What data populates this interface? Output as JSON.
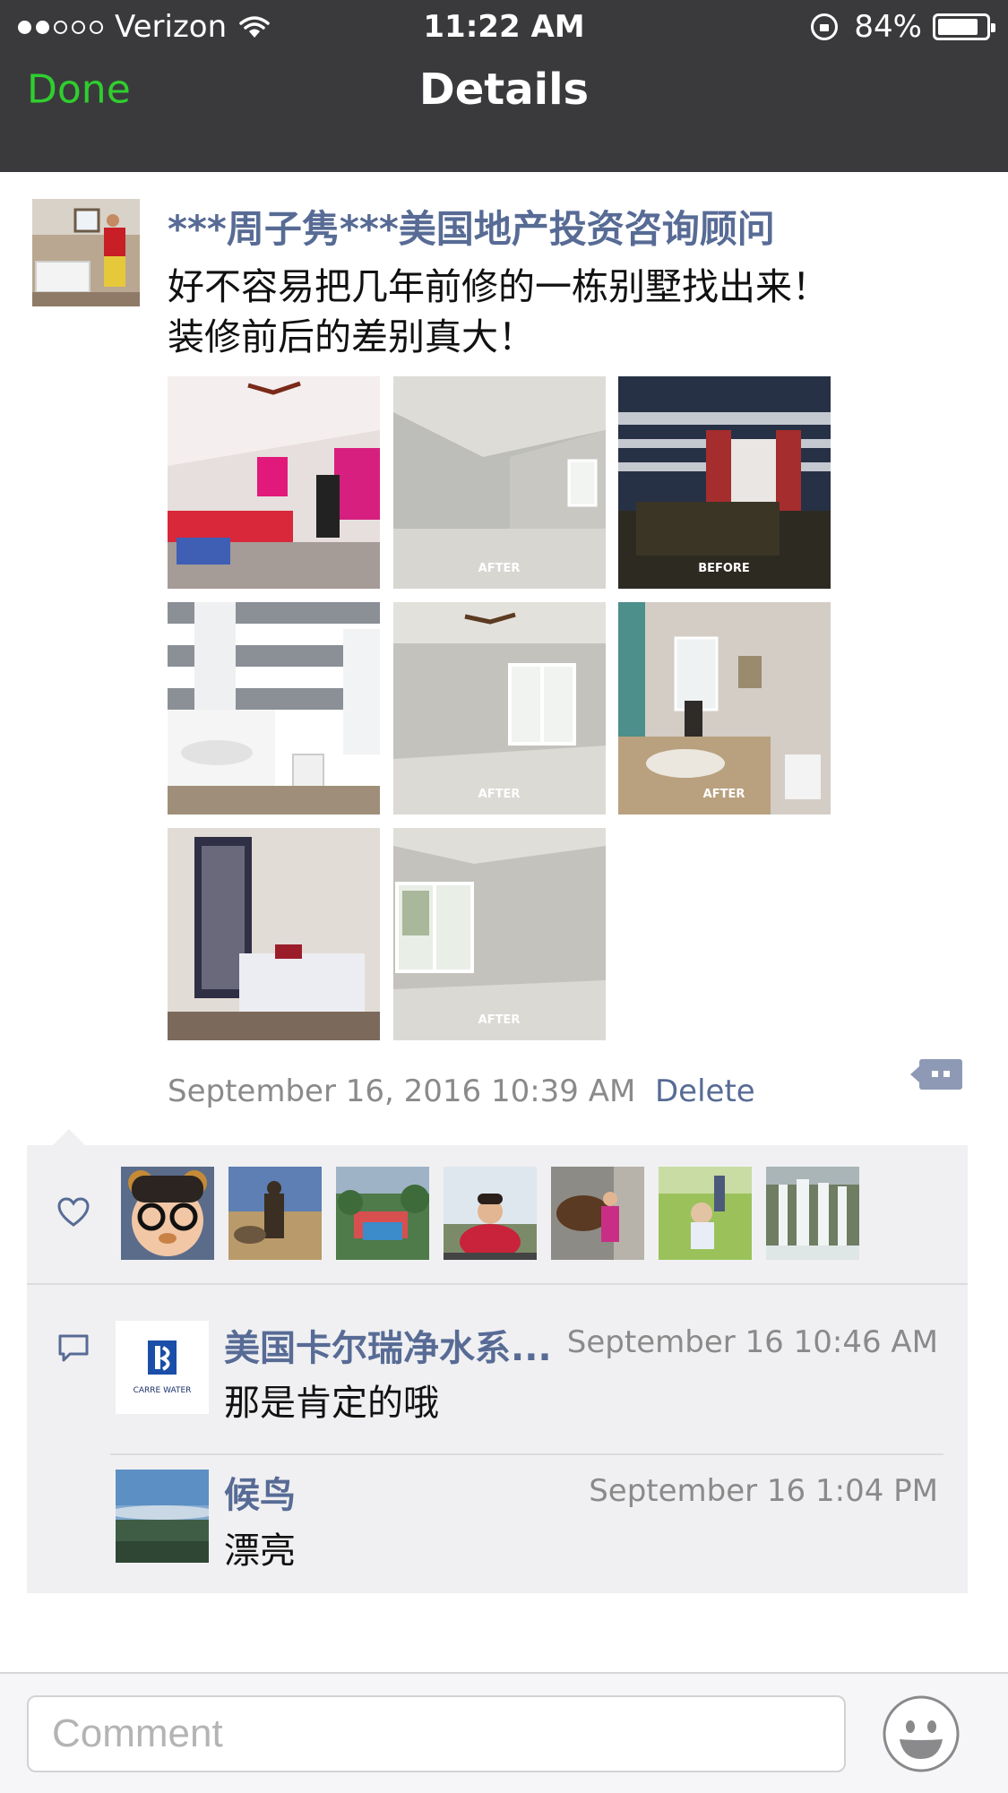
{
  "status_bar": {
    "signal_bars_filled": 2,
    "signal_bars_total": 5,
    "carrier": "Verizon",
    "time": "11:22 AM",
    "battery": "84%",
    "battery_level": 0.84
  },
  "nav": {
    "done_label": "Done",
    "title": "Details"
  },
  "post": {
    "author": "***周子隽***美国地产投资咨询顾问",
    "text": "好不容易把几年前修的一栋别墅找出来！\n装修前后的差别真大！",
    "timestamp": "September 16, 2016 10:39 AM",
    "delete_label": "Delete",
    "photos": [
      {
        "caption": ""
      },
      {
        "caption": "AFTER"
      },
      {
        "caption": "BEFORE"
      },
      {
        "caption": ""
      },
      {
        "caption": "AFTER"
      },
      {
        "caption": "AFTER"
      },
      {
        "caption": ""
      },
      {
        "caption": "AFTER"
      }
    ]
  },
  "likes": {
    "count": 7
  },
  "comments": [
    {
      "avatar_text": "CARRE WATER",
      "name": "美国卡尔瑞净水系...",
      "time": "September 16 10:46 AM",
      "text": "那是肯定的哦"
    },
    {
      "name": "候鸟",
      "time": "September 16 1:04 PM",
      "text": "漂亮"
    }
  ],
  "composer": {
    "placeholder": "Comment"
  },
  "colors": {
    "nav_bg": "#3a3a3c",
    "done_green": "#2fce2f",
    "link_blue": "#576b95",
    "panel_bg": "#f0f0f2"
  },
  "icons": [
    "wifi-icon",
    "orientation-lock-icon",
    "battery-icon",
    "more-actions-icon",
    "heart-icon",
    "comment-icon",
    "emoji-icon"
  ]
}
